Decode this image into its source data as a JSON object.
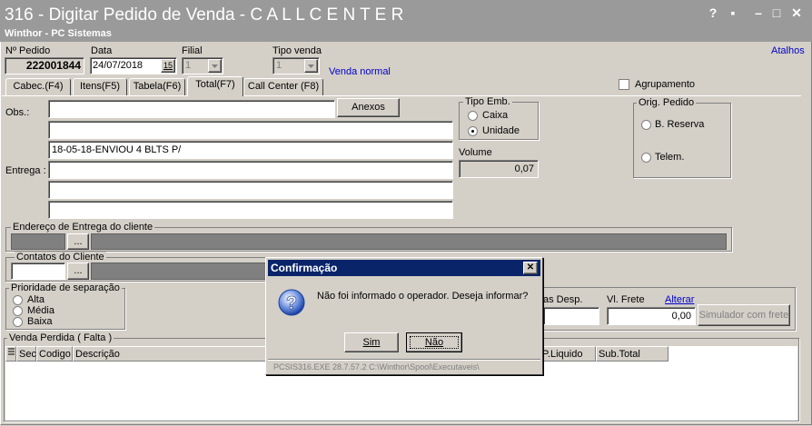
{
  "window": {
    "title": "316 - Digitar Pedido de Venda - C A L L   C E N T E R",
    "subtitle": "Winthor - PC Sistemas",
    "controls": {
      "help": "?",
      "restore": "▪",
      "minimize": "–",
      "maximize": "□",
      "close": "✕"
    }
  },
  "header": {
    "pedido_label": "Nº Pedido",
    "pedido_value": "222001844",
    "data_label": "Data",
    "data_value": "24/07/2018",
    "calendar_icon": "15",
    "filial_label": "Filial",
    "filial_value": "1",
    "tipo_venda_label": "Tipo venda",
    "tipo_venda_value": "1",
    "tipo_venda_desc": "Venda normal",
    "atalhos": "Atalhos",
    "agrupamento": "Agrupamento"
  },
  "tabs": [
    {
      "label": "Cabec.(F4)"
    },
    {
      "label": "Itens(F5)"
    },
    {
      "label": "Tabela(F6)"
    },
    {
      "label": "Total(F7)"
    },
    {
      "label": "Call Center (F8)"
    }
  ],
  "form": {
    "obs_label": "Obs.:",
    "anexos_button": "Anexos",
    "obs_line3": "18-05-18-ENVIOU 4 BLTS P/",
    "entrega_label": "Entrega :",
    "tipo_emb_label": "Tipo Emb.",
    "caixa": "Caixa",
    "unidade": "Unidade",
    "volume_label": "Volume",
    "volume_value": "0,07",
    "orig_pedido_label": "Orig. Pedido",
    "b_reserva": "B. Reserva",
    "telem": "Telem.",
    "endereco_label": "Endereço de Entrega do cliente",
    "contatos_label": "Contatos do Cliente",
    "ellipsis": "...",
    "prioridade_label": "Prioridade de separação",
    "alta": "Alta",
    "media": "Média",
    "baixa": "Baixa",
    "desp_label": "as Desp.",
    "frete_label": "Vl. Frete",
    "alterar_link": "Alterar",
    "frete_value": "0,00",
    "simulador_button": "Simulador com frete"
  },
  "venda_perdida": {
    "label": "Venda Perdida ( Falta )",
    "columns": [
      "Sec",
      "Codigo",
      "Descrição",
      "P.Liquido",
      "Sub.Total"
    ]
  },
  "dialog": {
    "title": "Confirmação",
    "close": "✕",
    "icon_glyph": "?",
    "message": "Não foi informado o operador. Deseja informar?",
    "yes_button": "Sim",
    "no_button": "Não",
    "status": "PCSIS316.EXE 28.7.57.2  C:\\Winthor\\Spool\\Executaveis\\"
  }
}
